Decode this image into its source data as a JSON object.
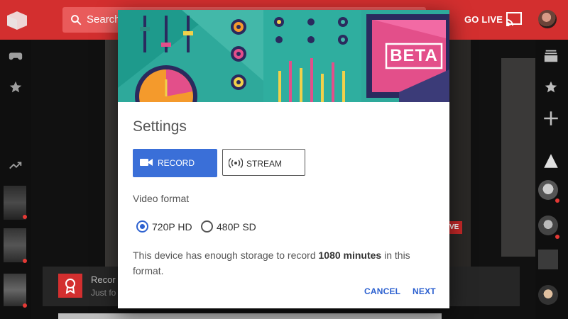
{
  "app": {
    "search_placeholder": "Search",
    "go_live_label": "GO LIVE",
    "notification": {
      "title": "Recor",
      "subtitle": "Just fo"
    },
    "live_badge": "VE"
  },
  "dialog": {
    "banner_badge": "BETA",
    "title": "Settings",
    "tabs": {
      "record_label": "RECORD",
      "stream_label": "STREAM",
      "selected": "record"
    },
    "video_format_label": "Video format",
    "formats": [
      {
        "label": "720P HD",
        "selected": true
      },
      {
        "label": "480P SD",
        "selected": false
      }
    ],
    "description": {
      "prefix": "This device has enough storage to record ",
      "highlight": "1080 minutes",
      "suffix": " in this format."
    },
    "actions": {
      "cancel_label": "CANCEL",
      "next_label": "NEXT"
    }
  },
  "colors": {
    "brand_red": "#d32f2f",
    "accent_blue": "#3a6fd8",
    "banner_teal": "#2ea99b"
  }
}
